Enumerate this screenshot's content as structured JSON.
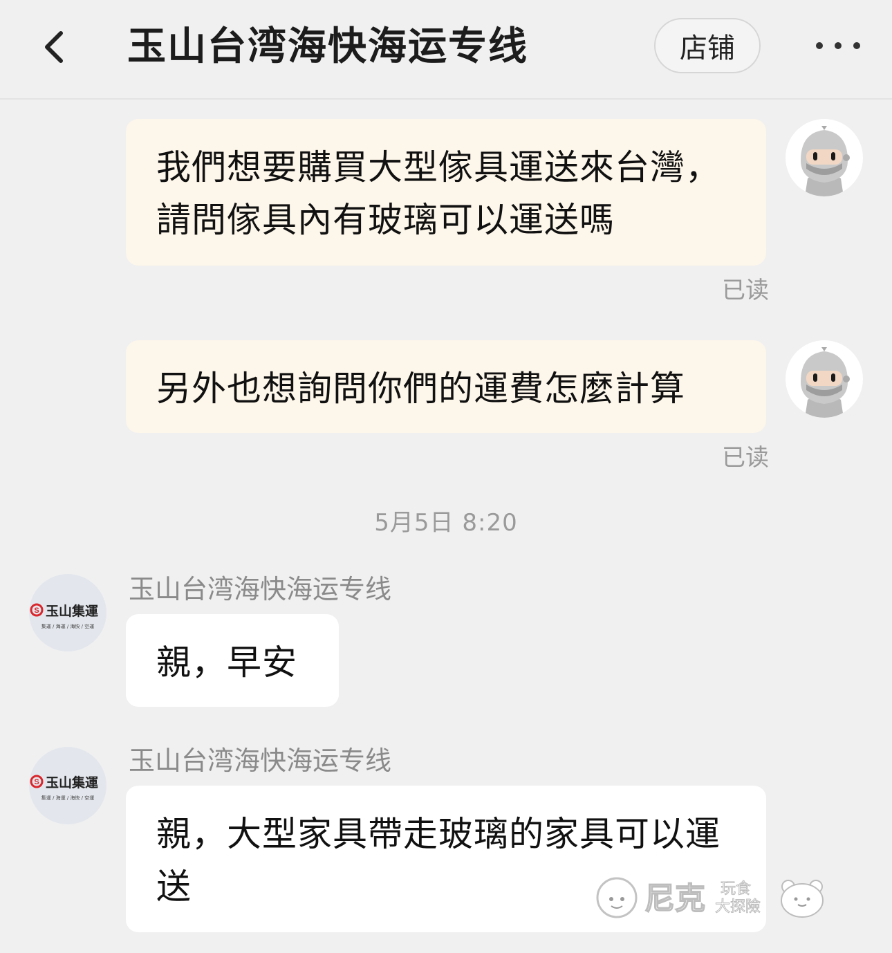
{
  "header": {
    "title": "玉山台湾海快海运专线",
    "shop_button": "店铺"
  },
  "messages": [
    {
      "text": "我們想要購買大型傢具運送來台灣，請問傢具內有玻璃可以運送嗎",
      "read_label": "已读"
    },
    {
      "text": "另外也想詢問你們的運費怎麼計算",
      "read_label": "已读"
    },
    {
      "text": "親，早安",
      "sender": "玉山台湾海快海运专线"
    },
    {
      "text": "親，大型家具帶走玻璃的家具可以運送",
      "sender": "玉山台湾海快海运专线"
    }
  ],
  "timestamp": "5月5日 8:20",
  "shop_avatar": {
    "brand": "玉山集運",
    "tagline": "集運 / 海運 / 海快 / 空運"
  },
  "watermark": {
    "name": "尼克",
    "sub_top": "玩食",
    "sub_bottom": "大探險"
  }
}
